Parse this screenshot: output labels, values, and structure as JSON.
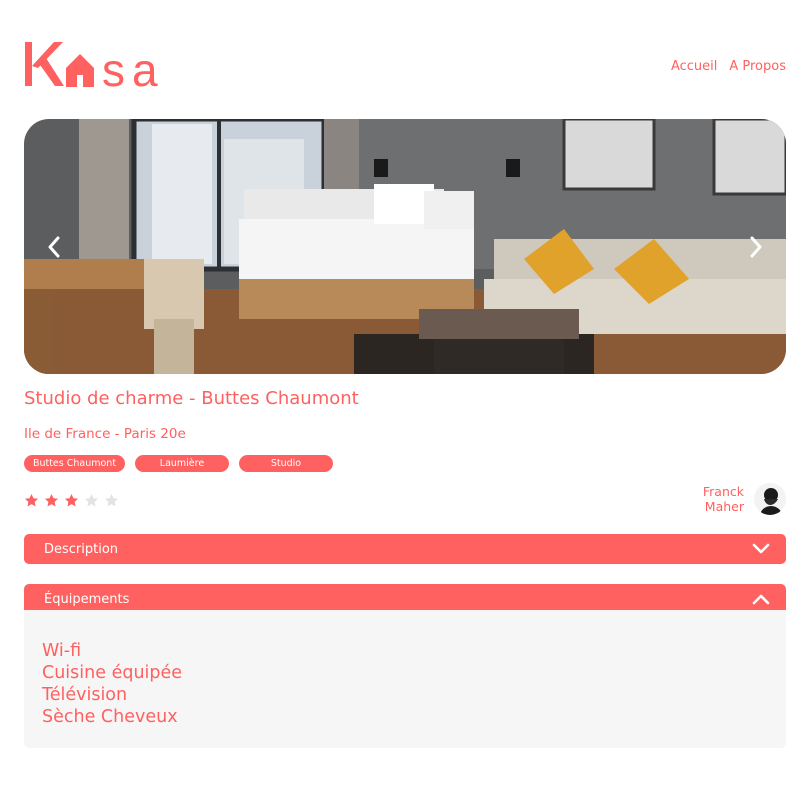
{
  "header": {
    "logo_text": "Kasa",
    "nav": [
      {
        "label": "Accueil"
      },
      {
        "label": "A Propos"
      }
    ]
  },
  "carousel": {
    "prev_icon": "chevron-left-icon",
    "next_icon": "chevron-right-icon"
  },
  "listing": {
    "title": "Studio de charme - Buttes Chaumont",
    "location": "Ile de France - Paris 20e",
    "tags": [
      "Buttes Chaumont",
      "Laumière",
      "Studio"
    ],
    "rating": 3,
    "rating_max": 5,
    "host": {
      "first_name": "Franck",
      "last_name": "Maher"
    }
  },
  "collapses": {
    "description": {
      "label": "Description",
      "state": "collapsed"
    },
    "equipments": {
      "label": "Équipements",
      "state": "expanded",
      "items": [
        "Wi-fi",
        "Cuisine équipée",
        "Télévision",
        "Sèche Cheveux"
      ]
    }
  },
  "colors": {
    "accent": "#FF6060",
    "star_off": "#E3E3E3",
    "panel_bg": "#F6F6F6"
  }
}
